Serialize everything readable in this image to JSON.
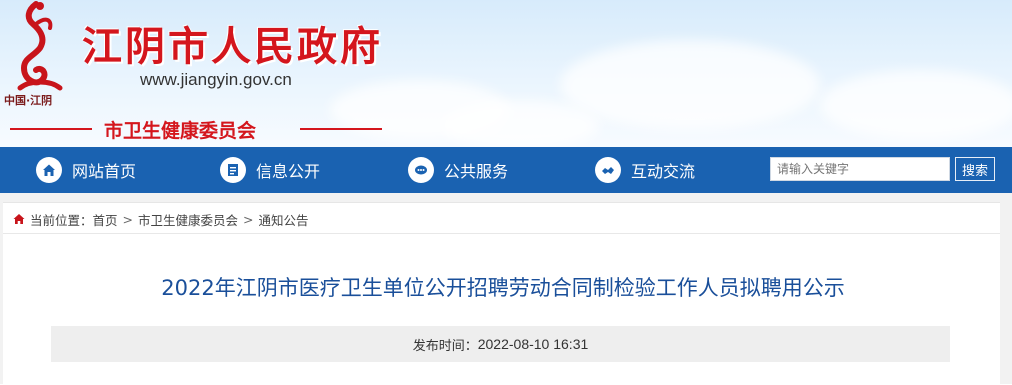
{
  "header": {
    "site_title": "江阴市人民政府",
    "site_url": "www.jiangyin.gov.cn",
    "logo_text": "中国·江阴",
    "department": "市卫生健康委员会",
    "colors": {
      "brand_red": "#d4161d",
      "sky": "#d7ebfb"
    }
  },
  "nav": {
    "items": [
      {
        "label": "网站首页",
        "icon": "home-icon"
      },
      {
        "label": "信息公开",
        "icon": "document-icon"
      },
      {
        "label": "公共服务",
        "icon": "service-icon"
      },
      {
        "label": "互动交流",
        "icon": "interaction-icon"
      }
    ],
    "color": "#1a62b1"
  },
  "search": {
    "placeholder": "请输入关键字",
    "button_label": "搜索"
  },
  "breadcrumb": {
    "prefix": "当前位置：",
    "items": [
      "首页",
      "市卫生健康委员会",
      "通知公告"
    ],
    "separator": ">"
  },
  "article": {
    "title": "2022年江阴市医疗卫生单位公开招聘劳动合同制检验工作人员拟聘用公示",
    "publish_label": "发布时间：",
    "publish_time": "2022-08-10 16:31"
  }
}
